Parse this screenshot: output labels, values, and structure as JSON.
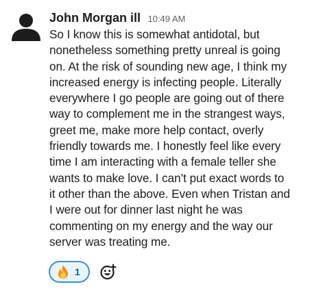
{
  "message": {
    "author": "John Morgan ill",
    "timestamp": "10:49 AM",
    "text": "So I know this is somewhat antidotal, but\nnonetheless something pretty unreal is going\non. At the risk of sounding new age, I think my\nincreased energy is infecting people. Literally\neverywhere I go people are going out of there\nway to complement me in the strangest ways,\ngreet me, make more help contact, overly\nfriendly towards me. I honestly feel like every\ntime I am interacting with a female teller she\nwants to make love. I can’t put exact words to\nit other than the above. Even when Tristan and\nI were out for dinner last night he was\ncommenting on my energy and the way our\nserver was treating me.",
    "avatar_icon": "person-icon"
  },
  "reactions": [
    {
      "emoji_icon": "fire-icon",
      "count": "1"
    }
  ],
  "add_reaction": {
    "icon": "add-reaction-icon"
  },
  "colors": {
    "text": "#1d1c1d",
    "timestamp": "#616061",
    "reaction_border": "#3b8fd0",
    "reaction_bg": "#e8f5fa",
    "reaction_count": "#1264a3"
  }
}
